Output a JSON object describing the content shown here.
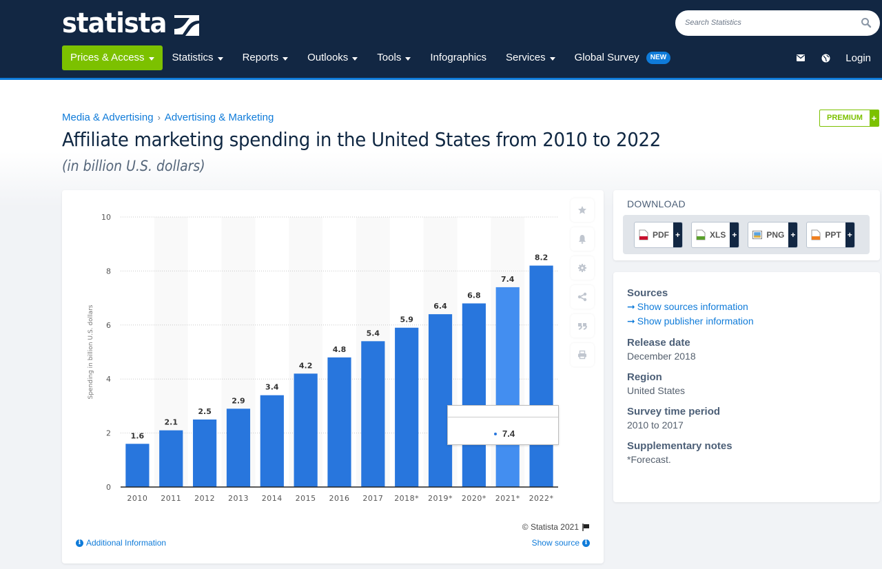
{
  "header": {
    "logo_text": "statista",
    "search_placeholder": "Search Statistics",
    "nav": [
      {
        "label": "Prices & Access",
        "dropdown": true
      },
      {
        "label": "Statistics",
        "dropdown": true
      },
      {
        "label": "Reports",
        "dropdown": true
      },
      {
        "label": "Outlooks",
        "dropdown": true
      },
      {
        "label": "Tools",
        "dropdown": true
      },
      {
        "label": "Infographics",
        "dropdown": false
      },
      {
        "label": "Services",
        "dropdown": true
      },
      {
        "label": "Global Survey",
        "dropdown": false,
        "badge": "NEW"
      }
    ],
    "login": "Login",
    "icons": [
      "mail-icon",
      "globe-icon"
    ]
  },
  "breadcrumb": [
    "Media & Advertising",
    "Advertising & Marketing"
  ],
  "breadcrumb_sep": "›",
  "title": "Affiliate marketing spending in the United States from 2010 to 2022",
  "subtitle": "(in billion U.S. dollars)",
  "premium_label": "PREMIUM",
  "premium_plus": "+",
  "colors": {
    "header_bg": "#122743",
    "accent_blue": "#0f7bd9",
    "brand_green": "#7cc100",
    "bar": "#2876dd",
    "bar_hover": "#438ef0"
  },
  "chart_data": {
    "type": "bar",
    "title": "Affiliate marketing spending in the United States from 2010 to 2022",
    "xlabel": "",
    "ylabel": "Spending in billion U.S. dollars",
    "categories": [
      "2010",
      "2011",
      "2012",
      "2013",
      "2014",
      "2015",
      "2016",
      "2017",
      "2018*",
      "2019*",
      "2020*",
      "2021*",
      "2022*"
    ],
    "values": [
      1.6,
      2.1,
      2.5,
      2.9,
      3.4,
      4.2,
      4.8,
      5.4,
      5.9,
      6.4,
      6.8,
      7.4,
      8.2
    ],
    "data_labels": [
      "1.6",
      "2.1",
      "2.5",
      "2.9",
      "3.4",
      "4.2",
      "4.8",
      "5.4",
      "5.9",
      "6.4",
      "6.8",
      "7.4",
      "8.2"
    ],
    "ylim": [
      0,
      10
    ],
    "yticks": [
      0,
      2,
      4,
      6,
      8,
      10
    ],
    "grid": true,
    "highlighted_index": 11
  },
  "tooltip": {
    "value": "7.4"
  },
  "chart_tools": [
    "star-icon",
    "bell-icon",
    "gear-icon",
    "share-icon",
    "quote-icon",
    "print-icon"
  ],
  "chart_footer": {
    "copyright": "© Statista 2021",
    "additional_info": "Additional Information",
    "show_source": "Show source"
  },
  "download": {
    "title": "DOWNLOAD",
    "buttons": [
      {
        "label": "PDF",
        "plus": "+"
      },
      {
        "label": "XLS",
        "plus": "+"
      },
      {
        "label": "PNG",
        "plus": "+"
      },
      {
        "label": "PPT",
        "plus": "+"
      }
    ]
  },
  "info": {
    "sources_heading": "Sources",
    "sources_links": [
      "Show sources information",
      "Show publisher information"
    ],
    "release_date_heading": "Release date",
    "release_date": "December 2018",
    "region_heading": "Region",
    "region": "United States",
    "survey_period_heading": "Survey time period",
    "survey_period": "2010 to 2017",
    "notes_heading": "Supplementary notes",
    "notes": "*Forecast."
  }
}
